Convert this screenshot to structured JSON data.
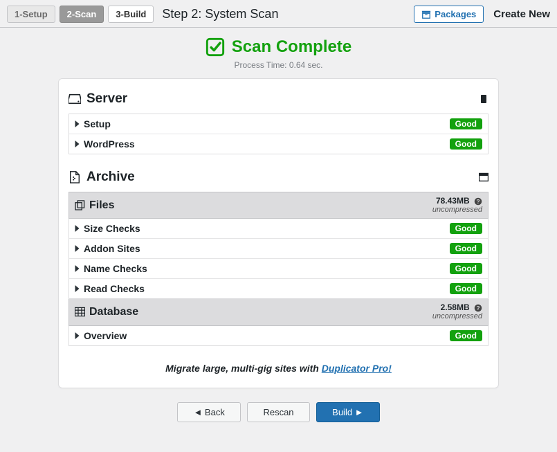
{
  "topbar": {
    "steps": [
      {
        "label": "1-Setup",
        "state": "done"
      },
      {
        "label": "2-Scan",
        "state": "active"
      },
      {
        "label": "3-Build",
        "state": "pending"
      }
    ],
    "title": "Step 2: System Scan",
    "packages_label": "Packages",
    "create_new_label": "Create New"
  },
  "scan": {
    "title": "Scan Complete",
    "subtitle": "Process Time: 0.64 sec."
  },
  "server": {
    "title": "Server",
    "items": [
      {
        "label": "Setup",
        "status": "Good"
      },
      {
        "label": "WordPress",
        "status": "Good"
      }
    ]
  },
  "archive": {
    "title": "Archive",
    "files": {
      "title": "Files",
      "size": "78.43MB",
      "compression": "uncompressed",
      "items": [
        {
          "label": "Size Checks",
          "status": "Good"
        },
        {
          "label": "Addon Sites",
          "status": "Good"
        },
        {
          "label": "Name Checks",
          "status": "Good"
        },
        {
          "label": "Read Checks",
          "status": "Good"
        }
      ]
    },
    "database": {
      "title": "Database",
      "size": "2.58MB",
      "compression": "uncompressed",
      "items": [
        {
          "label": "Overview",
          "status": "Good"
        }
      ]
    }
  },
  "promo": {
    "text": "Migrate large, multi-gig sites with ",
    "link_text": "Duplicator Pro!"
  },
  "footer": {
    "back": "◄ Back",
    "rescan": "Rescan",
    "build": "Build ►"
  }
}
